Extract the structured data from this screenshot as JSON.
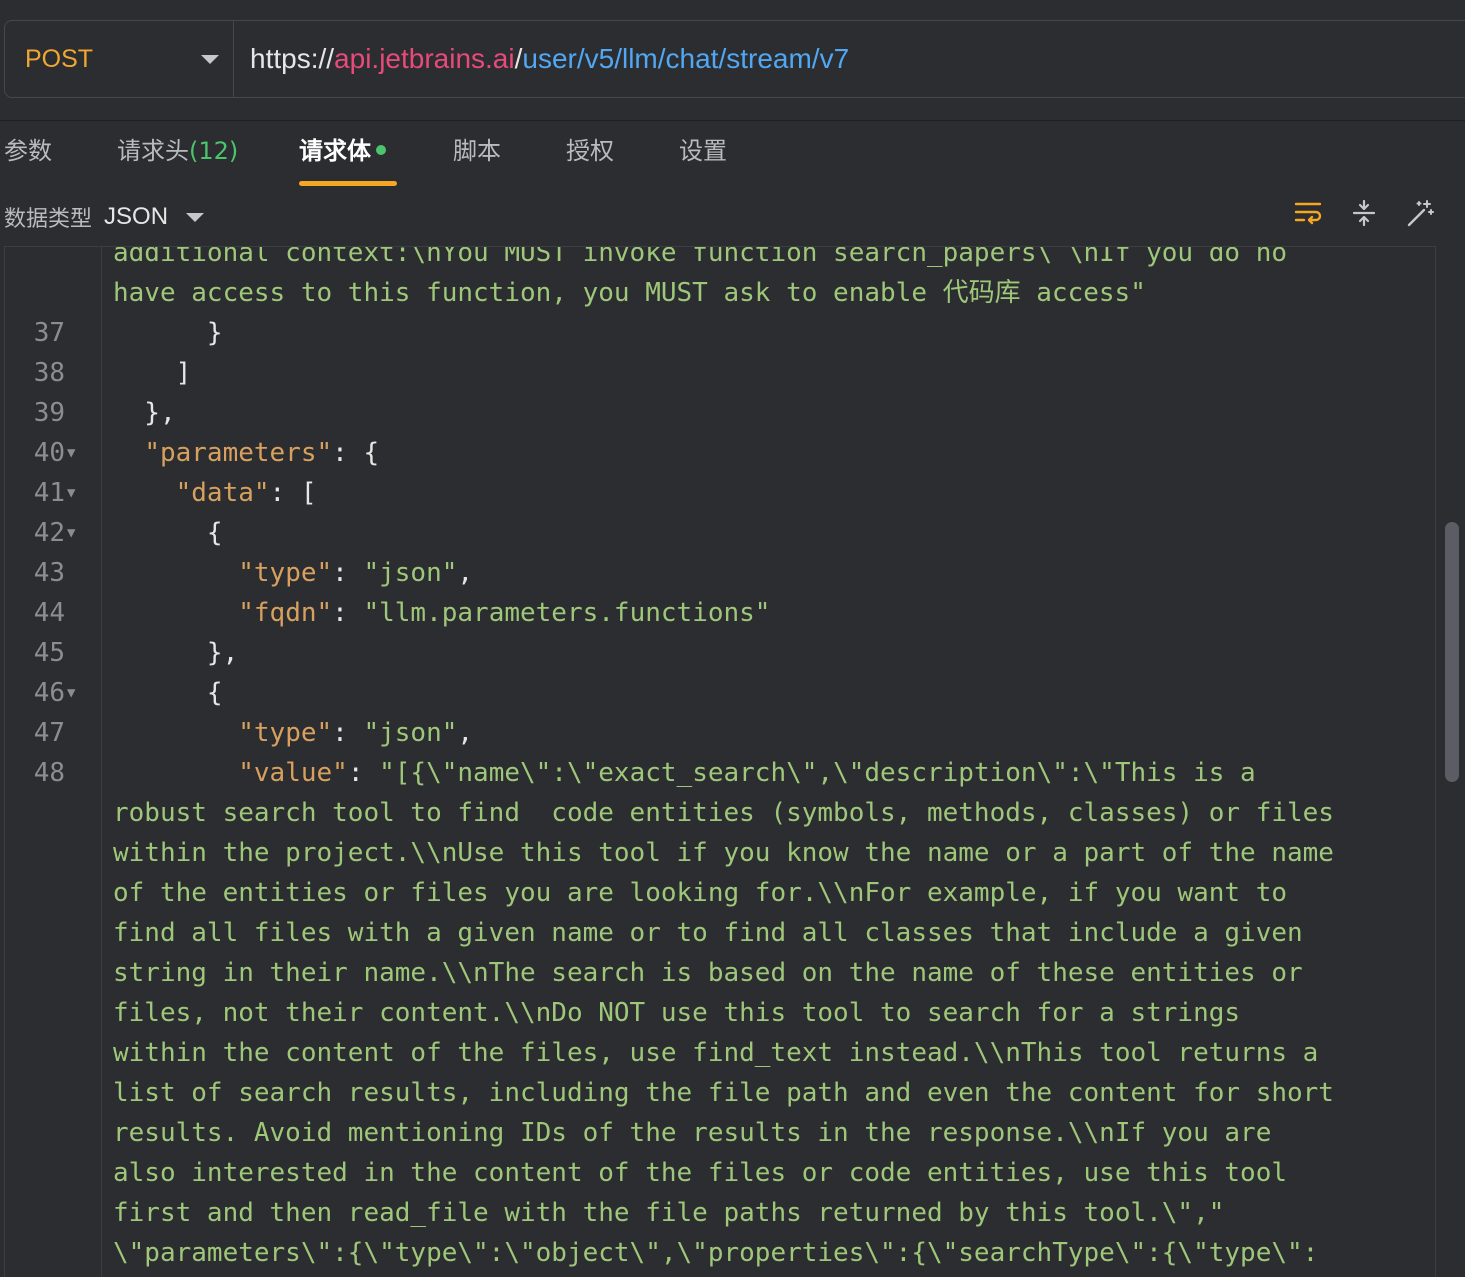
{
  "request": {
    "method": "POST",
    "url_scheme": "https://",
    "url_host": "api.jetbrains.ai",
    "url_sep": "/",
    "url_path": "user/v5/llm/chat/stream/v7"
  },
  "tabs": [
    {
      "label": "参数",
      "count": ""
    },
    {
      "label": "请求头",
      "count": "(12)"
    },
    {
      "label": "请求体",
      "count": ""
    },
    {
      "label": "脚本",
      "count": ""
    },
    {
      "label": "授权",
      "count": ""
    },
    {
      "label": "设置",
      "count": ""
    }
  ],
  "body_type": {
    "label": "数据类型",
    "value": "JSON"
  },
  "editor": {
    "lines": [
      {
        "num": "",
        "text": "additional context:\\nYou MUST invoke function search_papers\\ \\nIf you do no"
      },
      {
        "num": "",
        "text": "have access to this function, you MUST ask to enable 代码库 access\""
      },
      {
        "num": "37",
        "text": "      }"
      },
      {
        "num": "38",
        "text": "    ]"
      },
      {
        "num": "39",
        "text": "  },"
      },
      {
        "num": "40",
        "k": "\"parameters\"",
        "pre": "  ",
        "rest": ": {"
      },
      {
        "num": "41",
        "k": "\"data\"",
        "pre": "    ",
        "rest": ": ["
      },
      {
        "num": "42",
        "text": "      {"
      },
      {
        "num": "43",
        "k": "\"type\"",
        "pre": "        ",
        "rest": ": ",
        "v": "\"json\"",
        "end": ","
      },
      {
        "num": "44",
        "k": "\"fqdn\"",
        "pre": "        ",
        "rest": ": ",
        "v": "\"llm.parameters.functions\"",
        "end": ""
      },
      {
        "num": "45",
        "text": "      },"
      },
      {
        "num": "46",
        "text": "      {"
      },
      {
        "num": "47",
        "k": "\"type\"",
        "pre": "        ",
        "rest": ": ",
        "v": "\"json\"",
        "end": ","
      },
      {
        "num": "48",
        "k": "\"value\"",
        "pre": "        ",
        "rest": ": ",
        "v": "\"[{\\\"name\\\":\\\"exact_search\\\",\\\"description\\\":\\\"This is a",
        "end": ""
      },
      {
        "num": "",
        "text": "robust search tool to find  code entities (symbols, methods, classes) or files"
      },
      {
        "num": "",
        "text": "within the project.\\\\nUse this tool if you know the name or a part of the name"
      },
      {
        "num": "",
        "text": "of the entities or files you are looking for.\\\\nFor example, if you want to"
      },
      {
        "num": "",
        "text": "find all files with a given name or to find all classes that include a given"
      },
      {
        "num": "",
        "text": "string in their name.\\\\nThe search is based on the name of these entities or"
      },
      {
        "num": "",
        "text": "files, not their content.\\\\nDo NOT use this tool to search for a strings"
      },
      {
        "num": "",
        "text": "within the content of the files, use find_text instead.\\\\nThis tool returns a"
      },
      {
        "num": "",
        "text": "list of search results, including the file path and even the content for short"
      },
      {
        "num": "",
        "text": "results. Avoid mentioning IDs of the results in the response.\\\\nIf you are"
      },
      {
        "num": "",
        "text": "also interested in the content of the files or code entities, use this tool"
      },
      {
        "num": "",
        "text": "first and then read_file with the file paths returned by this tool.\\\",\""
      },
      {
        "num": "",
        "text": "\\\"parameters\\\":{\\\"type\\\":\\\"object\\\",\\\"properties\\\":{\\\"searchType\\\":{\\\"type\\\":"
      }
    ]
  }
}
